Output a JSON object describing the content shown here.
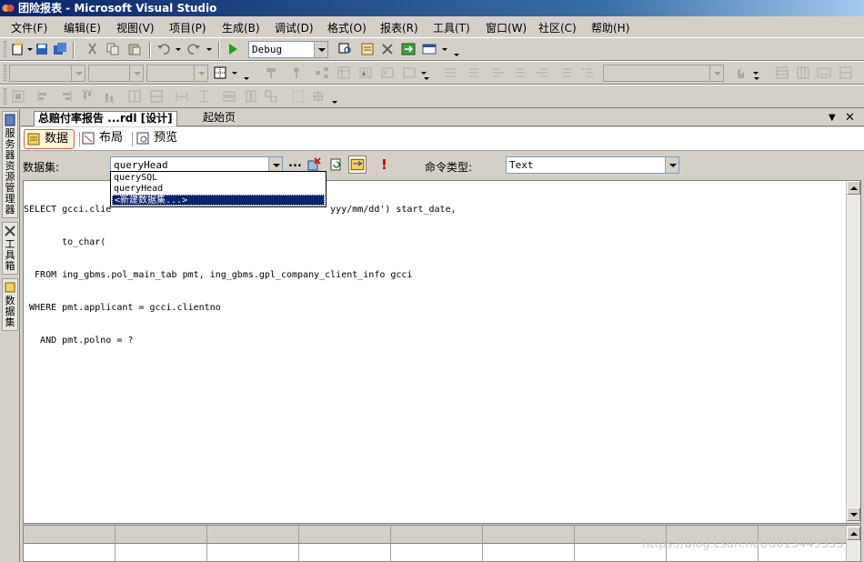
{
  "window": {
    "title": "团险报表 - Microsoft Visual Studio"
  },
  "menu": {
    "items": [
      {
        "label": "文件(F)"
      },
      {
        "label": "编辑(E)"
      },
      {
        "label": "视图(V)"
      },
      {
        "label": "项目(P)"
      },
      {
        "label": "生成(B)"
      },
      {
        "label": "调试(D)"
      },
      {
        "label": "格式(O)"
      },
      {
        "label": "报表(R)"
      },
      {
        "label": "工具(T)"
      },
      {
        "label": "窗口(W)"
      },
      {
        "label": "社区(C)"
      },
      {
        "label": "帮助(H)"
      }
    ]
  },
  "toolbar": {
    "config_value": "Debug"
  },
  "side_panel": {
    "tabs": [
      {
        "label": "服务器资源管理器"
      },
      {
        "label": "工具箱"
      },
      {
        "label": "数据集"
      }
    ]
  },
  "document": {
    "tabs": [
      {
        "label": "总赔付率报告 ...rdl [设计]",
        "active": true
      },
      {
        "label": "起始页",
        "active": false
      }
    ],
    "view_tabs": [
      {
        "label": "数据",
        "selected": true
      },
      {
        "label": "布局",
        "selected": false
      },
      {
        "label": "预览",
        "selected": false
      }
    ]
  },
  "dataset_bar": {
    "dataset_label": "数据集:",
    "dataset_value": "queryHead",
    "ellipsis_label": "...",
    "command_type_label": "命令类型:",
    "command_type_value": "Text"
  },
  "dataset_dropdown": {
    "options": [
      {
        "label": "querySQL"
      },
      {
        "label": "queryHead"
      },
      {
        "label": "<新建数据集...>",
        "highlighted": true
      }
    ]
  },
  "editor": {
    "lines": [
      "SELECT gcci.clie                                        yyy/mm/dd') start_date,",
      "       to_char(",
      "  FROM ing_gbms.pol_main_tab pmt, ing_gbms.gpl_company_client_info gcci",
      " WHERE pmt.applicant = gcci.clientno",
      "   AND pmt.polno = ?"
    ]
  },
  "watermark": {
    "text": "https://blog.csdn.net/u013449335"
  },
  "colors": {
    "title_bar": "#0a246a",
    "selection": "#0a246a",
    "chrome": "#d4d0c8"
  }
}
